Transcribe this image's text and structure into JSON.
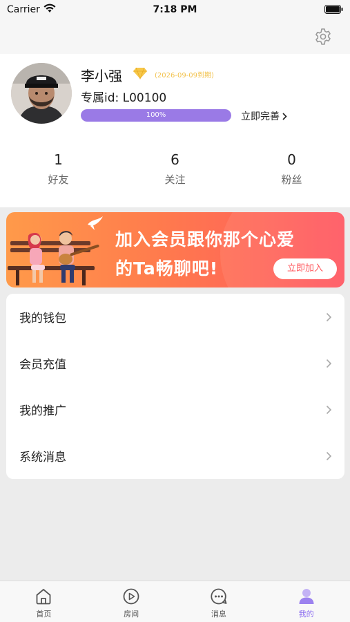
{
  "status_bar": {
    "carrier": "Carrier",
    "time": "7:18 PM"
  },
  "profile": {
    "name": "李小强",
    "expire": "(2026-09-09到期)",
    "uid": "专属id: L00100",
    "progress_text": "100%",
    "progress_value": 1.0,
    "complete_label": "立即完善",
    "stats": [
      {
        "value": "1",
        "label": "好友"
      },
      {
        "value": "6",
        "label": "关注"
      },
      {
        "value": "0",
        "label": "粉丝"
      }
    ]
  },
  "banner": {
    "line1": "加入会员跟你那个心爱",
    "line2": "的Ta畅聊吧!",
    "button": "立即加入"
  },
  "menu": {
    "items": [
      {
        "label": "我的钱包"
      },
      {
        "label": "会员充值"
      },
      {
        "label": "我的推广"
      },
      {
        "label": "系统消息"
      }
    ]
  },
  "tabbar": {
    "tabs": [
      {
        "label": "首页",
        "icon": "home-icon"
      },
      {
        "label": "房间",
        "icon": "play-icon"
      },
      {
        "label": "消息",
        "icon": "chat-icon"
      },
      {
        "label": "我的",
        "icon": "person-icon"
      }
    ],
    "active": 3
  },
  "colors": {
    "accent": "#8b6cf0",
    "banner_start": "#ff9a4a",
    "banner_end": "#ff5560",
    "vip": "#f2c24d"
  }
}
